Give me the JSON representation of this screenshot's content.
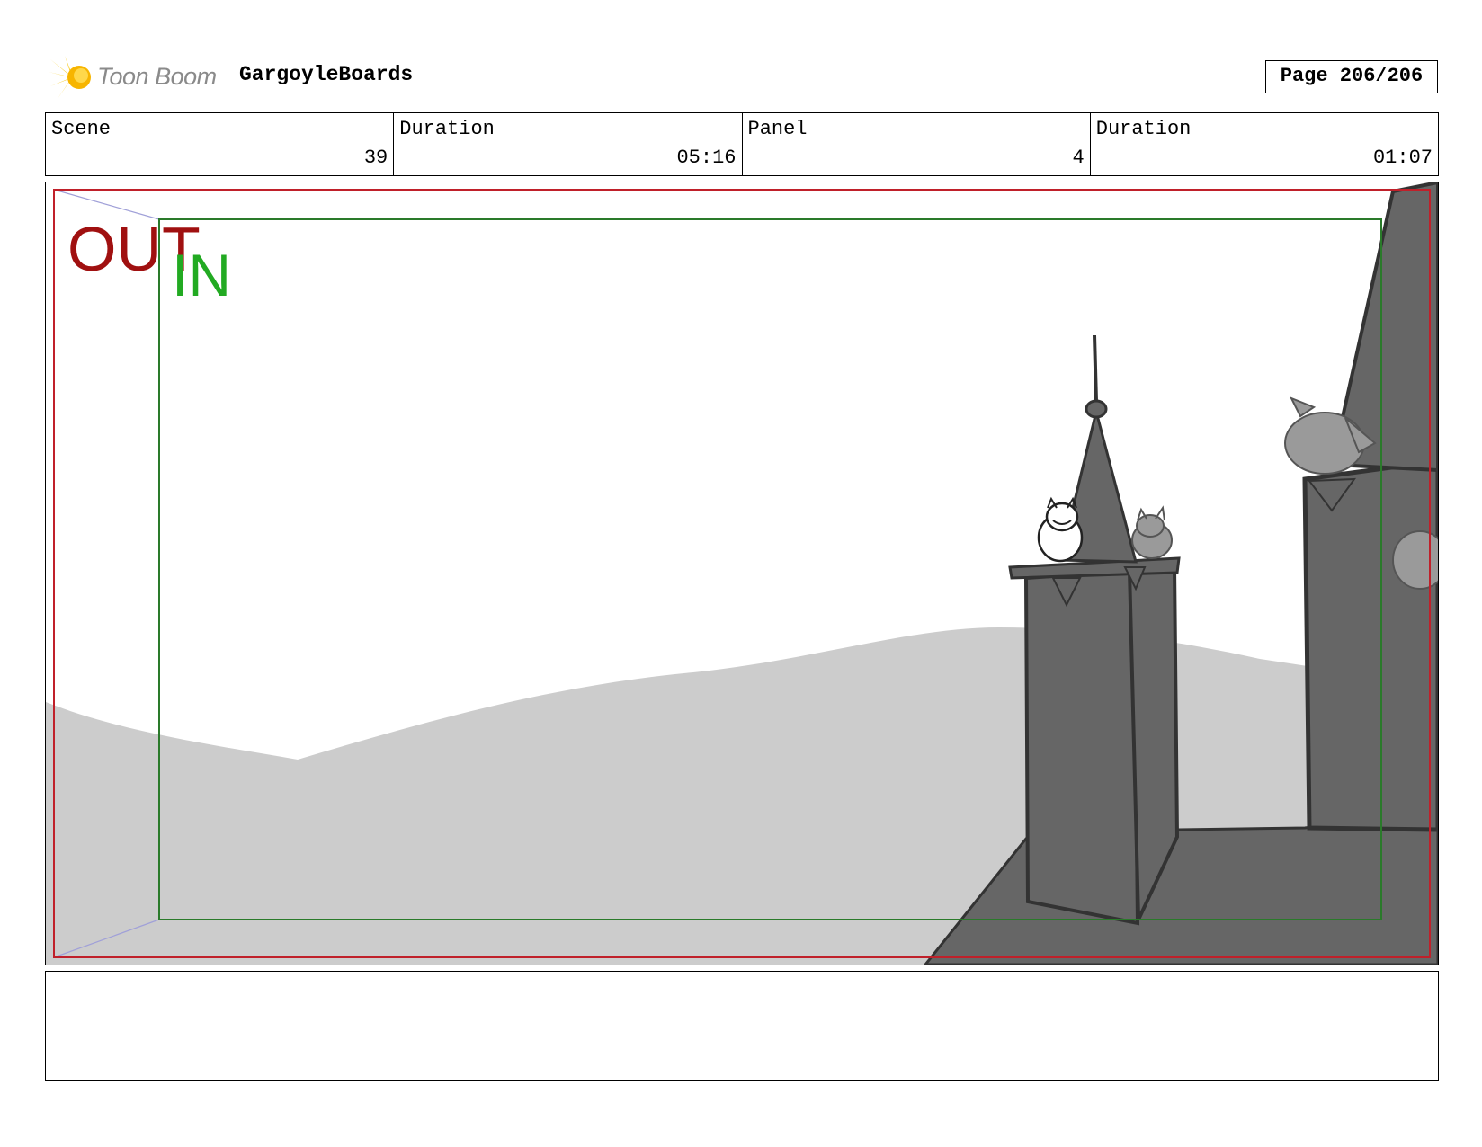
{
  "header": {
    "logo_text": "Toon Boom",
    "project_name": "GargoyleBoards",
    "page_label": "Page 206/206"
  },
  "info": {
    "scene_label": "Scene",
    "scene_value": "39",
    "scene_duration_label": "Duration",
    "scene_duration_value": "05:16",
    "panel_label": "Panel",
    "panel_value": "4",
    "panel_duration_label": "Duration",
    "panel_duration_value": "01:07"
  },
  "frame_labels": {
    "out": "OUT",
    "in": "IN"
  },
  "colors": {
    "out_frame": "#c0202a",
    "in_frame": "#2a7a2a",
    "out_text": "#a01010",
    "in_text": "#22aa22",
    "tower": "#666666",
    "hill": "#cccccc"
  },
  "notes": {
    "text": ""
  }
}
